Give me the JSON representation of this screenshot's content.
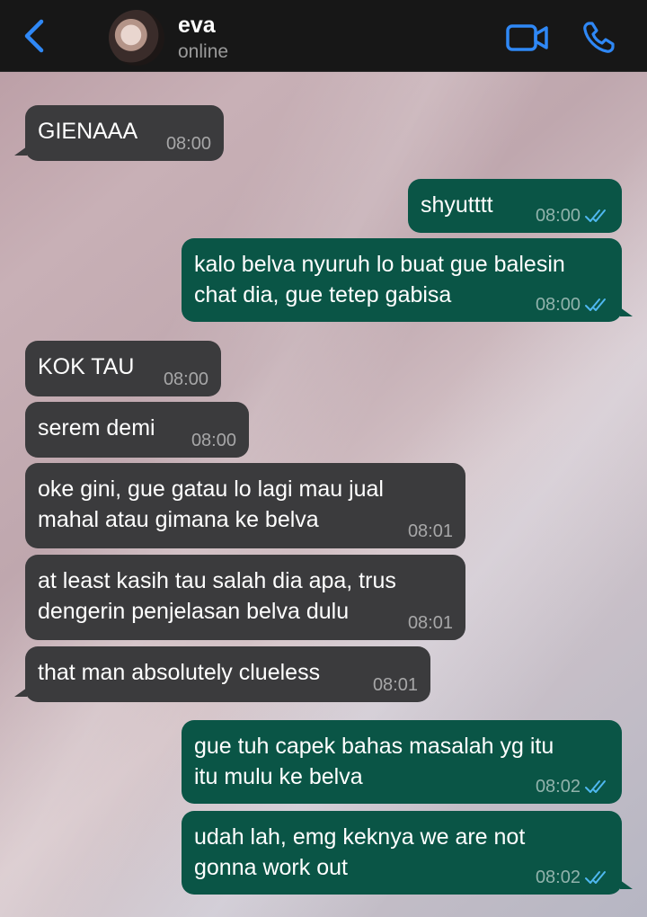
{
  "header": {
    "contact_name": "eva",
    "status": "online",
    "icons": {
      "back": "chevron-left-icon",
      "video": "video-camera-icon",
      "call": "phone-icon"
    },
    "accent_color": "#2f88f6"
  },
  "colors": {
    "incoming_bubble": "#3b3b3d",
    "outgoing_bubble": "#0a5546",
    "read_ticks": "#4fb8f0"
  },
  "messages": [
    {
      "direction": "incoming",
      "text": "GIENAAA",
      "time": "08:00",
      "tail": true
    },
    {
      "direction": "outgoing",
      "text": "shyutttt",
      "time": "08:00",
      "read": true,
      "tail": false
    },
    {
      "direction": "outgoing",
      "text": "kalo belva nyuruh lo buat gue balesin\nchat dia, gue tetep gabisa",
      "time": "08:00",
      "read": true,
      "tail": true
    },
    {
      "direction": "incoming",
      "text": "KOK TAU",
      "time": "08:00",
      "tail": false
    },
    {
      "direction": "incoming",
      "text": "serem demi",
      "time": "08:00",
      "tail": false
    },
    {
      "direction": "incoming",
      "text": "oke gini, gue gatau lo lagi mau jual\nmahal atau gimana ke belva",
      "time": "08:01",
      "tail": false
    },
    {
      "direction": "incoming",
      "text": "at least kasih tau salah dia apa, trus\ndengerin penjelasan belva dulu",
      "time": "08:01",
      "tail": false
    },
    {
      "direction": "incoming",
      "text": "that man absolutely clueless",
      "time": "08:01",
      "tail": true
    },
    {
      "direction": "outgoing",
      "text": "gue tuh capek bahas masalah yg itu\nitu mulu ke belva",
      "time": "08:02",
      "read": true,
      "tail": false
    },
    {
      "direction": "outgoing",
      "text": "udah lah, emg keknya we are not\ngonna work out",
      "time": "08:02",
      "read": true,
      "tail": true
    }
  ]
}
